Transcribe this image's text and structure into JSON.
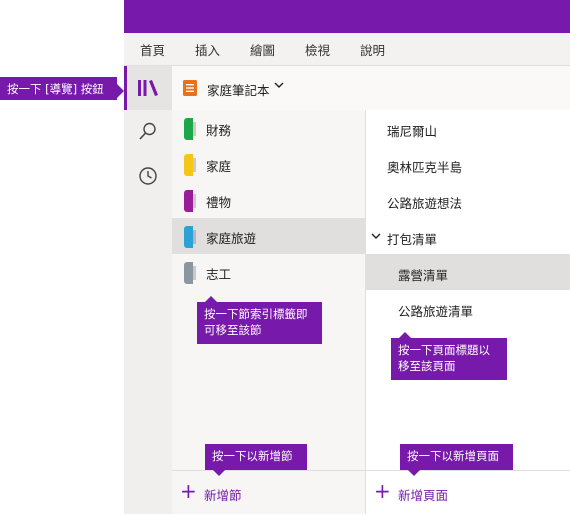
{
  "ribbon": {
    "tabs": [
      "首頁",
      "插入",
      "繪圖",
      "檢視",
      "說明"
    ]
  },
  "rail": {
    "icons": [
      "notebooks-icon",
      "search-icon",
      "recent-icon"
    ]
  },
  "notebook": {
    "name": "家庭筆記本",
    "icon_color": "#e8711c"
  },
  "sections": [
    {
      "label": "財務",
      "color": "#1ca84a",
      "selected": false
    },
    {
      "label": "家庭",
      "color": "#f5c518",
      "selected": false
    },
    {
      "label": "禮物",
      "color": "#9b1c9b",
      "selected": false
    },
    {
      "label": "家庭旅遊",
      "color": "#2aa2d8",
      "selected": true
    },
    {
      "label": "志工",
      "color": "#8b97a0",
      "selected": false
    }
  ],
  "pages": [
    {
      "label": "瑞尼爾山",
      "subpage": false,
      "selected": false,
      "collapsible": false
    },
    {
      "label": "奧林匹克半島",
      "subpage": false,
      "selected": false,
      "collapsible": false
    },
    {
      "label": "公路旅遊想法",
      "subpage": false,
      "selected": false,
      "collapsible": false
    },
    {
      "label": "打包清單",
      "subpage": false,
      "selected": false,
      "collapsible": true
    },
    {
      "label": "露營清單",
      "subpage": true,
      "selected": true,
      "collapsible": false
    },
    {
      "label": "公路旅遊清單",
      "subpage": true,
      "selected": false,
      "collapsible": false
    }
  ],
  "add_section_label": "新增節",
  "add_page_label": "新增頁面",
  "callouts": {
    "nav_button": "按一下 [導覽] 按鈕",
    "section_tab_line1": "按一下節索引標籤即",
    "section_tab_line2": "可移至該節",
    "page_title_line1": "按一下頁面標題以",
    "page_title_line2": "移至該頁面",
    "add_section": "按一下以新增節",
    "add_page": "按一下以新增頁面"
  },
  "colors": {
    "accent": "#7719aa",
    "selected_row": "#e1dfdd"
  }
}
